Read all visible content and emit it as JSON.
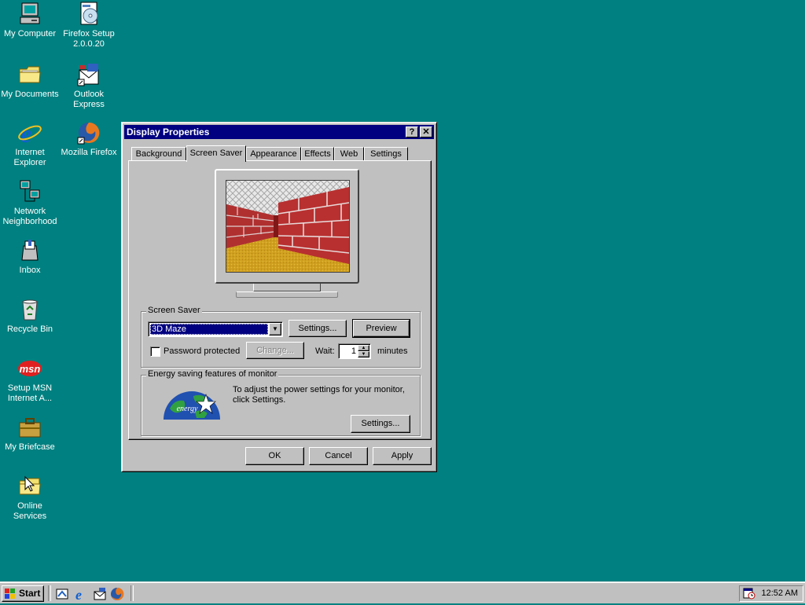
{
  "desktop": {
    "icons": [
      {
        "label": "My Computer",
        "icon": "my-computer-icon"
      },
      {
        "label": "Firefox Setup 2.0.0.20",
        "icon": "setup-cd-icon"
      },
      {
        "label": "My Documents",
        "icon": "folder-icon"
      },
      {
        "label": "Outlook Express",
        "icon": "outlook-express-icon"
      },
      {
        "label": "Internet Explorer",
        "icon": "internet-explorer-icon"
      },
      {
        "label": "Mozilla Firefox",
        "icon": "firefox-icon"
      },
      {
        "label": "Network Neighborhood",
        "icon": "network-icon"
      },
      {
        "label": "Inbox",
        "icon": "inbox-icon"
      },
      {
        "label": "Recycle Bin",
        "icon": "recycle-bin-icon"
      },
      {
        "label": "Setup MSN Internet A...",
        "icon": "msn-icon"
      },
      {
        "label": "My Briefcase",
        "icon": "briefcase-icon"
      },
      {
        "label": "Online Services",
        "icon": "online-services-folder-icon"
      }
    ]
  },
  "dialog": {
    "title": "Display Properties",
    "help_glyph": "?",
    "close_glyph": "✕",
    "tabs": [
      "Background",
      "Screen Saver",
      "Appearance",
      "Effects",
      "Web",
      "Settings"
    ],
    "active_tab": "Screen Saver",
    "screensaver": {
      "group_label": "Screen Saver",
      "selected": "3D Maze",
      "settings_label": "Settings...",
      "preview_label": "Preview",
      "password_label": "Password protected",
      "password_checked": false,
      "change_label": "Change...",
      "wait_label": "Wait:",
      "wait_value": "1",
      "minutes_label": "minutes"
    },
    "energy": {
      "group_label": "Energy saving features of monitor",
      "text": "To adjust the power settings for your monitor, click Settings.",
      "settings_label": "Settings...",
      "logo_text": "energy"
    },
    "buttons": {
      "ok": "OK",
      "cancel": "Cancel",
      "apply": "Apply"
    }
  },
  "taskbar": {
    "start_label": "Start",
    "quick_launch": [
      "show-desktop-icon",
      "internet-explorer-icon",
      "outlook-express-icon",
      "firefox-icon"
    ],
    "clock": "12:52 AM"
  },
  "colors": {
    "desktop": "#008080",
    "titlebar": "#000080",
    "face": "#c0c0c0",
    "selection": "#000080"
  }
}
